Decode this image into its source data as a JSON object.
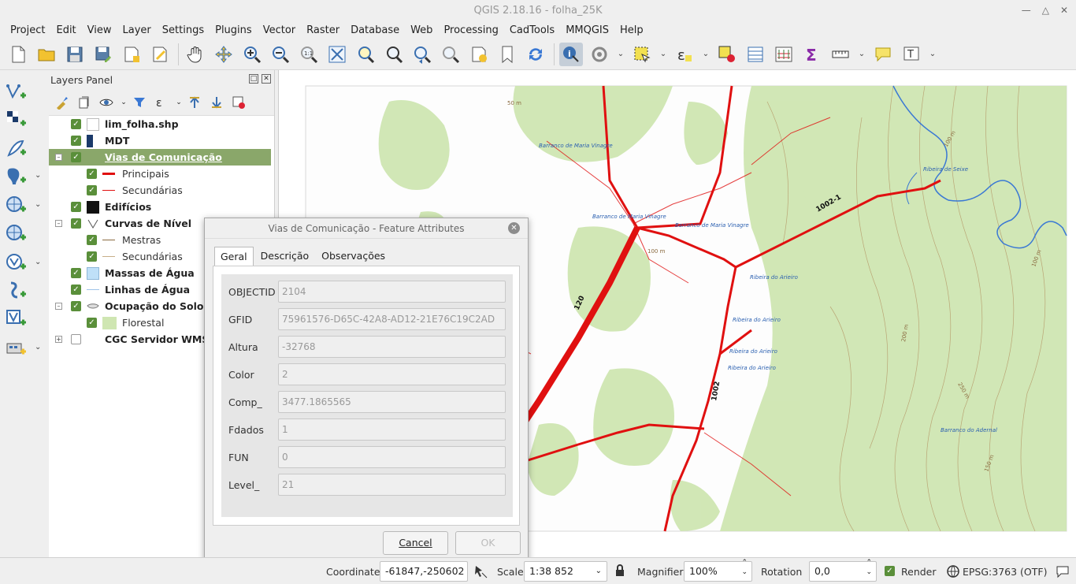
{
  "window": {
    "title": "QGIS 2.18.16 - folha_25K"
  },
  "menu": [
    "Project",
    "Edit",
    "View",
    "Layer",
    "Settings",
    "Plugins",
    "Vector",
    "Raster",
    "Database",
    "Web",
    "Processing",
    "CadTools",
    "MMQGIS",
    "Help"
  ],
  "layers_panel": {
    "title": "Layers Panel",
    "layers": [
      {
        "name": "lim_folha.shp",
        "checked": true,
        "bold": true,
        "symbol": "white-square"
      },
      {
        "name": "MDT",
        "checked": true,
        "bold": true,
        "symbol": "raster-icon"
      },
      {
        "name": "Vias de Comunicação",
        "checked": true,
        "bold": true,
        "selected": true,
        "expanded": true,
        "symbol": "none"
      },
      {
        "name": "Principais",
        "checked": true,
        "child": true,
        "symbol": "red-thick-line"
      },
      {
        "name": "Secundárias",
        "checked": true,
        "child": true,
        "symbol": "red-thin-line"
      },
      {
        "name": "Edifícios",
        "checked": true,
        "bold": true,
        "symbol": "black-square"
      },
      {
        "name": "Curvas de Nível",
        "checked": true,
        "bold": true,
        "expanded": true,
        "symbol": "contour-icon"
      },
      {
        "name": "Mestras",
        "checked": true,
        "child": true,
        "symbol": "brown-line"
      },
      {
        "name": "Secundárias",
        "checked": true,
        "child": true,
        "symbol": "light-brown-line"
      },
      {
        "name": "Massas de Água",
        "checked": true,
        "bold": true,
        "symbol": "light-blue-square"
      },
      {
        "name": "Linhas de Água",
        "checked": true,
        "bold": true,
        "symbol": "blue-line"
      },
      {
        "name": "Ocupação do Solo",
        "checked": true,
        "bold": true,
        "expanded": true,
        "symbol": "polygon-icon"
      },
      {
        "name": "Florestal",
        "checked": true,
        "child": true,
        "symbol": "light-green-square"
      },
      {
        "name": "CGC Servidor WMS",
        "checked": false,
        "bold": true,
        "collapsed": true,
        "symbol": "none"
      }
    ]
  },
  "dialog": {
    "title": "Vias de Comunicação - Feature Attributes",
    "tabs": [
      "Geral",
      "Descrição",
      "Observações"
    ],
    "fields": [
      {
        "label": "OBJECTID",
        "value": "2104"
      },
      {
        "label": "GFID",
        "value": "75961576-D65C-42A8-AD12-21E76C19C2AD"
      },
      {
        "label": "Altura",
        "value": "-32768"
      },
      {
        "label": "Color",
        "value": "2"
      },
      {
        "label": "Comp_",
        "value": "3477.1865565"
      },
      {
        "label": "Fdados",
        "value": "1"
      },
      {
        "label": "FUN",
        "value": "0"
      },
      {
        "label": "Level_",
        "value": "21"
      }
    ],
    "cancel_label": "Cancel",
    "ok_label": "OK"
  },
  "map": {
    "labels": {
      "barranco1": "Barranco de Maria Vinagre",
      "barranco2": "Barranco de Maria Vinagre",
      "barranco3": "Barranco de Maria Vinagre",
      "ribeira_seixe": "Ribeira de Seixe",
      "ribeira_arieiro1": "Ribeira do Arieiro",
      "ribeira_arieiro2": "Ribeira do Arieiro",
      "ribeira_arieiro3": "Ribeira do Arieiro",
      "ribeira_arieiro4": "Ribeira do Arieiro",
      "barranco_adernal": "Barranco do Adernal",
      "road_1002_1": "1002-1",
      "road_1002": "1002",
      "road_120": "120",
      "c50": "50 m",
      "c100a": "100 m",
      "c100b": "100 m",
      "c100c": "100 m",
      "c150": "150 m",
      "c200": "200 m",
      "c250": "250 m"
    },
    "colors": {
      "road": "#e01010",
      "water": "#3a78d4",
      "forest": "#cfe6b2",
      "contour": "#b08a5a"
    }
  },
  "statusbar": {
    "coordinate_label": "Coordinate",
    "coordinate_value": "-61847,-250602",
    "scale_label": "Scale",
    "scale_value": "1:38 852",
    "magnifier_label": "Magnifier",
    "magnifier_value": "100%",
    "rotation_label": "Rotation",
    "rotation_value": "0,0",
    "render_label": "Render",
    "crs_label": "EPSG:3763 (OTF)"
  }
}
